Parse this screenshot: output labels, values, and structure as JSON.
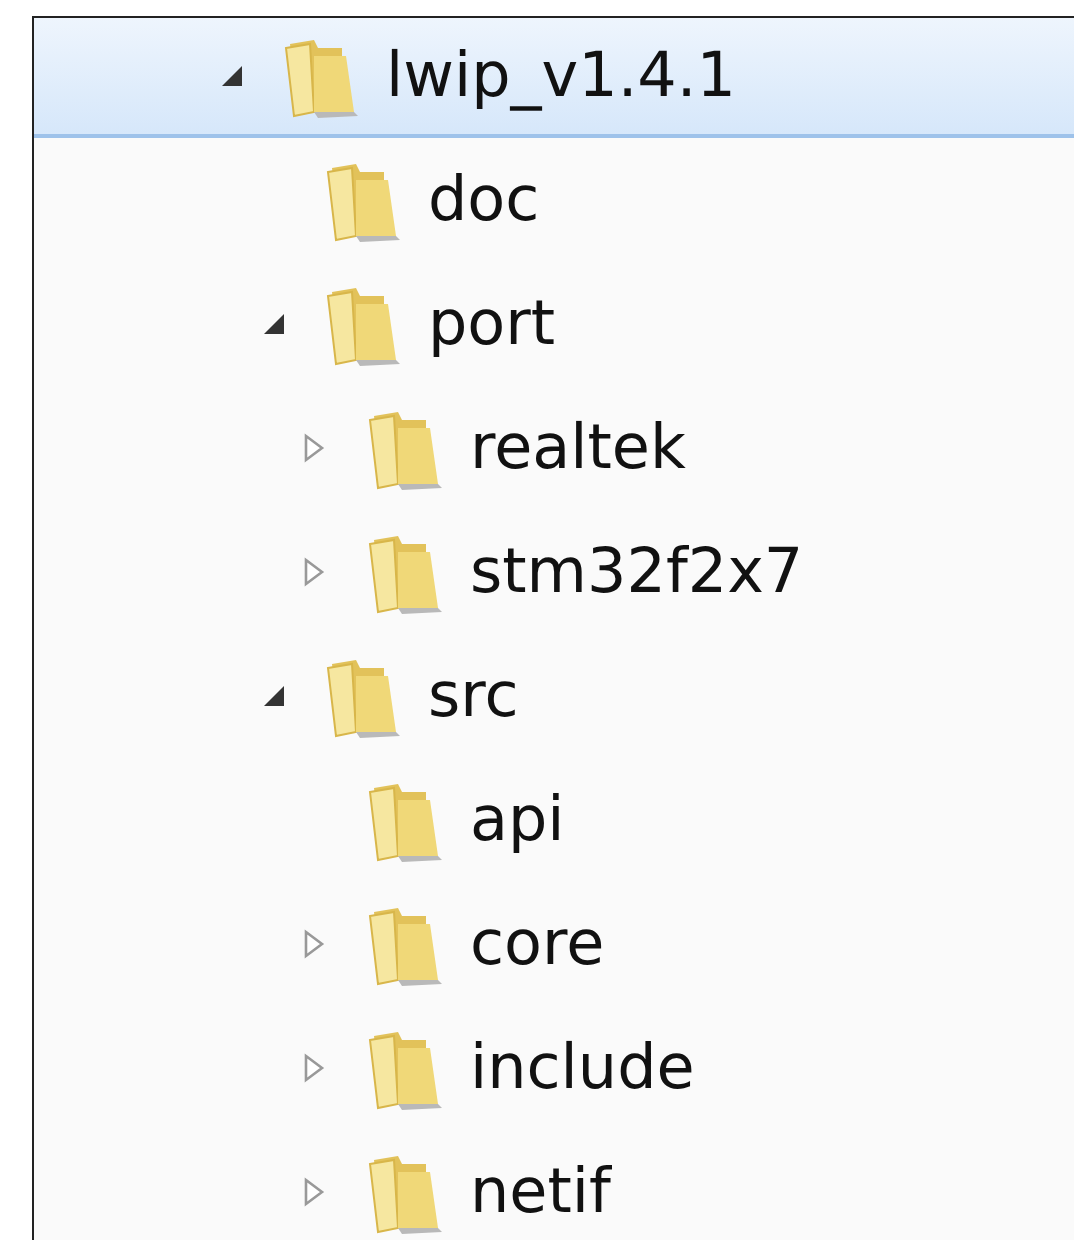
{
  "tree": [
    {
      "label": "lwip_v1.4.1",
      "expanded": true,
      "selected": true,
      "children": [
        {
          "label": "doc",
          "selected": false
        },
        {
          "label": "port",
          "expanded": true,
          "selected": false,
          "children": [
            {
              "label": "realtek",
              "expanded": false,
              "selected": false
            },
            {
              "label": "stm32f2x7",
              "expanded": false,
              "selected": false
            }
          ]
        },
        {
          "label": "src",
          "expanded": true,
          "selected": false,
          "children": [
            {
              "label": "api",
              "selected": false
            },
            {
              "label": "core",
              "expanded": false,
              "selected": false
            },
            {
              "label": "include",
              "expanded": false,
              "selected": false
            },
            {
              "label": "netif",
              "expanded": false,
              "selected": false
            }
          ]
        }
      ]
    }
  ]
}
